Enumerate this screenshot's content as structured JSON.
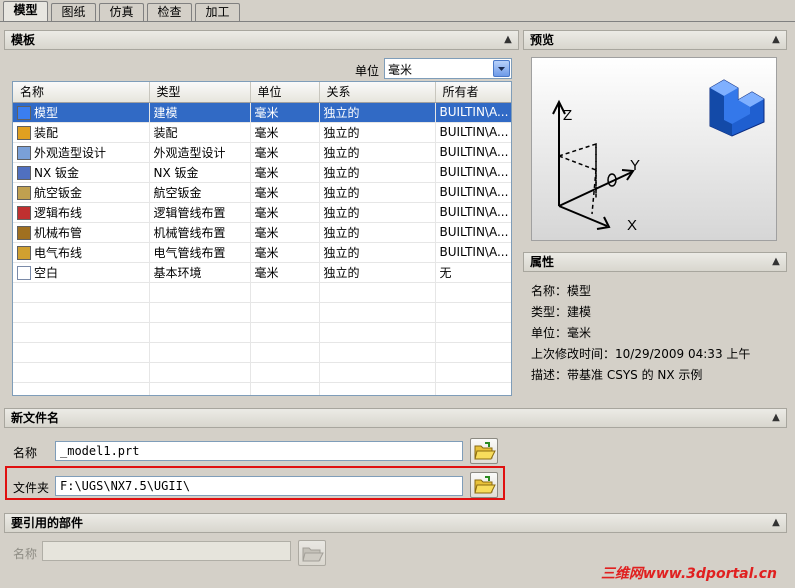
{
  "tabs": [
    "模型",
    "图纸",
    "仿真",
    "检查",
    "加工"
  ],
  "template_section": {
    "title": "模板",
    "unit_label": "单位",
    "unit_value": "毫米",
    "columns": [
      "名称",
      "类型",
      "单位",
      "关系",
      "所有者"
    ],
    "rows": [
      {
        "icon": "model-icon",
        "name": "模型",
        "type": "建模",
        "unit": "毫米",
        "relation": "独立的",
        "owner": "BUILTIN\\A...",
        "selected": true
      },
      {
        "icon": "assembly-icon",
        "name": "装配",
        "type": "装配",
        "unit": "毫米",
        "relation": "独立的",
        "owner": "BUILTIN\\A..."
      },
      {
        "icon": "shape-studio-icon",
        "name": "外观造型设计",
        "type": "外观造型设计",
        "unit": "毫米",
        "relation": "独立的",
        "owner": "BUILTIN\\A..."
      },
      {
        "icon": "sheet-metal-icon",
        "name": "NX 钣金",
        "type": "NX 钣金",
        "unit": "毫米",
        "relation": "独立的",
        "owner": "BUILTIN\\A..."
      },
      {
        "icon": "aero-sheet-metal-icon",
        "name": "航空钣金",
        "type": "航空钣金",
        "unit": "毫米",
        "relation": "独立的",
        "owner": "BUILTIN\\A..."
      },
      {
        "icon": "logical-routing-icon",
        "name": "逻辑布线",
        "type": "逻辑管线布置",
        "unit": "毫米",
        "relation": "独立的",
        "owner": "BUILTIN\\A..."
      },
      {
        "icon": "mechanical-routing-icon",
        "name": "机械布管",
        "type": "机械管线布置",
        "unit": "毫米",
        "relation": "独立的",
        "owner": "BUILTIN\\A..."
      },
      {
        "icon": "electrical-routing-icon",
        "name": "电气布线",
        "type": "电气管线布置",
        "unit": "毫米",
        "relation": "独立的",
        "owner": "BUILTIN\\A..."
      },
      {
        "icon": "blank-icon",
        "name": "空白",
        "type": "基本环境",
        "unit": "毫米",
        "relation": "独立的",
        "owner": "无"
      }
    ]
  },
  "preview_section": {
    "title": "预览",
    "axis_labels": {
      "z": "Z",
      "y": "Y",
      "x": "X"
    }
  },
  "properties_section": {
    "title": "属性",
    "name_label": "名称：",
    "name_value": "模型",
    "type_label": "类型：",
    "type_value": "建模",
    "unit_label": "单位：",
    "unit_value": "毫米",
    "modified_label": "上次修改时间：",
    "modified_value": "10/29/2009 04:33 上午",
    "desc_label": "描述：",
    "desc_value": "带基准 CSYS 的 NX 示例"
  },
  "new_file_section": {
    "title": "新文件名",
    "name_label": "名称",
    "name_value": "_model1.prt",
    "folder_label": "文件夹",
    "folder_value": "F:\\UGS\\NX7.5\\UGII\\"
  },
  "reference_section": {
    "title": "要引用的部件",
    "name_label": "名称",
    "name_value": ""
  },
  "watermark": "三维网www.3dportal.cn",
  "colors": {
    "selection": "#316ac5",
    "highlight_box": "#e01010",
    "accent_blue": "#1f5fd0"
  }
}
